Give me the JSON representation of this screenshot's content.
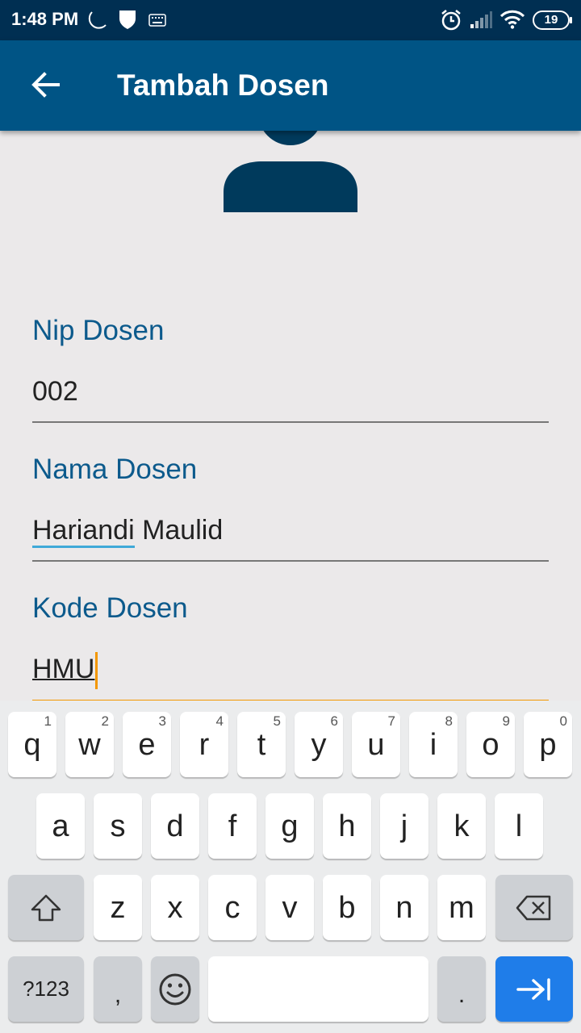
{
  "status_bar": {
    "time": "1:48 PM",
    "battery": "19",
    "icons": [
      "moon-icon",
      "shield-icon",
      "keyboard-icon",
      "alarm-icon",
      "signal-icon",
      "wifi-icon",
      "battery-icon"
    ]
  },
  "app_bar": {
    "title": "Tambah Dosen",
    "back_icon": "arrow-back-icon"
  },
  "avatar": {
    "icon": "person-icon"
  },
  "form": {
    "nip_label": "Nip Dosen",
    "nip_value": "002",
    "nama_label": "Nama Dosen",
    "nama_value_part1": "Hariandi",
    "nama_value_part2": " Maulid",
    "kode_label": "Kode Dosen",
    "kode_value": "HMU"
  },
  "keyboard": {
    "row1": [
      {
        "key": "q",
        "hint": "1"
      },
      {
        "key": "w",
        "hint": "2"
      },
      {
        "key": "e",
        "hint": "3"
      },
      {
        "key": "r",
        "hint": "4"
      },
      {
        "key": "t",
        "hint": "5"
      },
      {
        "key": "y",
        "hint": "6"
      },
      {
        "key": "u",
        "hint": "7"
      },
      {
        "key": "i",
        "hint": "8"
      },
      {
        "key": "o",
        "hint": "9"
      },
      {
        "key": "p",
        "hint": "0"
      }
    ],
    "row2": [
      "a",
      "s",
      "d",
      "f",
      "g",
      "h",
      "j",
      "k",
      "l"
    ],
    "row3": [
      "z",
      "x",
      "c",
      "v",
      "b",
      "n",
      "m"
    ],
    "symbols_label": "?123",
    "comma": ",",
    "period": ".",
    "colors": {
      "enter": "#1f7de9",
      "app_bar": "#005485",
      "status_bar": "#002f52",
      "label": "#0c5a8c",
      "focus": "#f39700"
    }
  }
}
